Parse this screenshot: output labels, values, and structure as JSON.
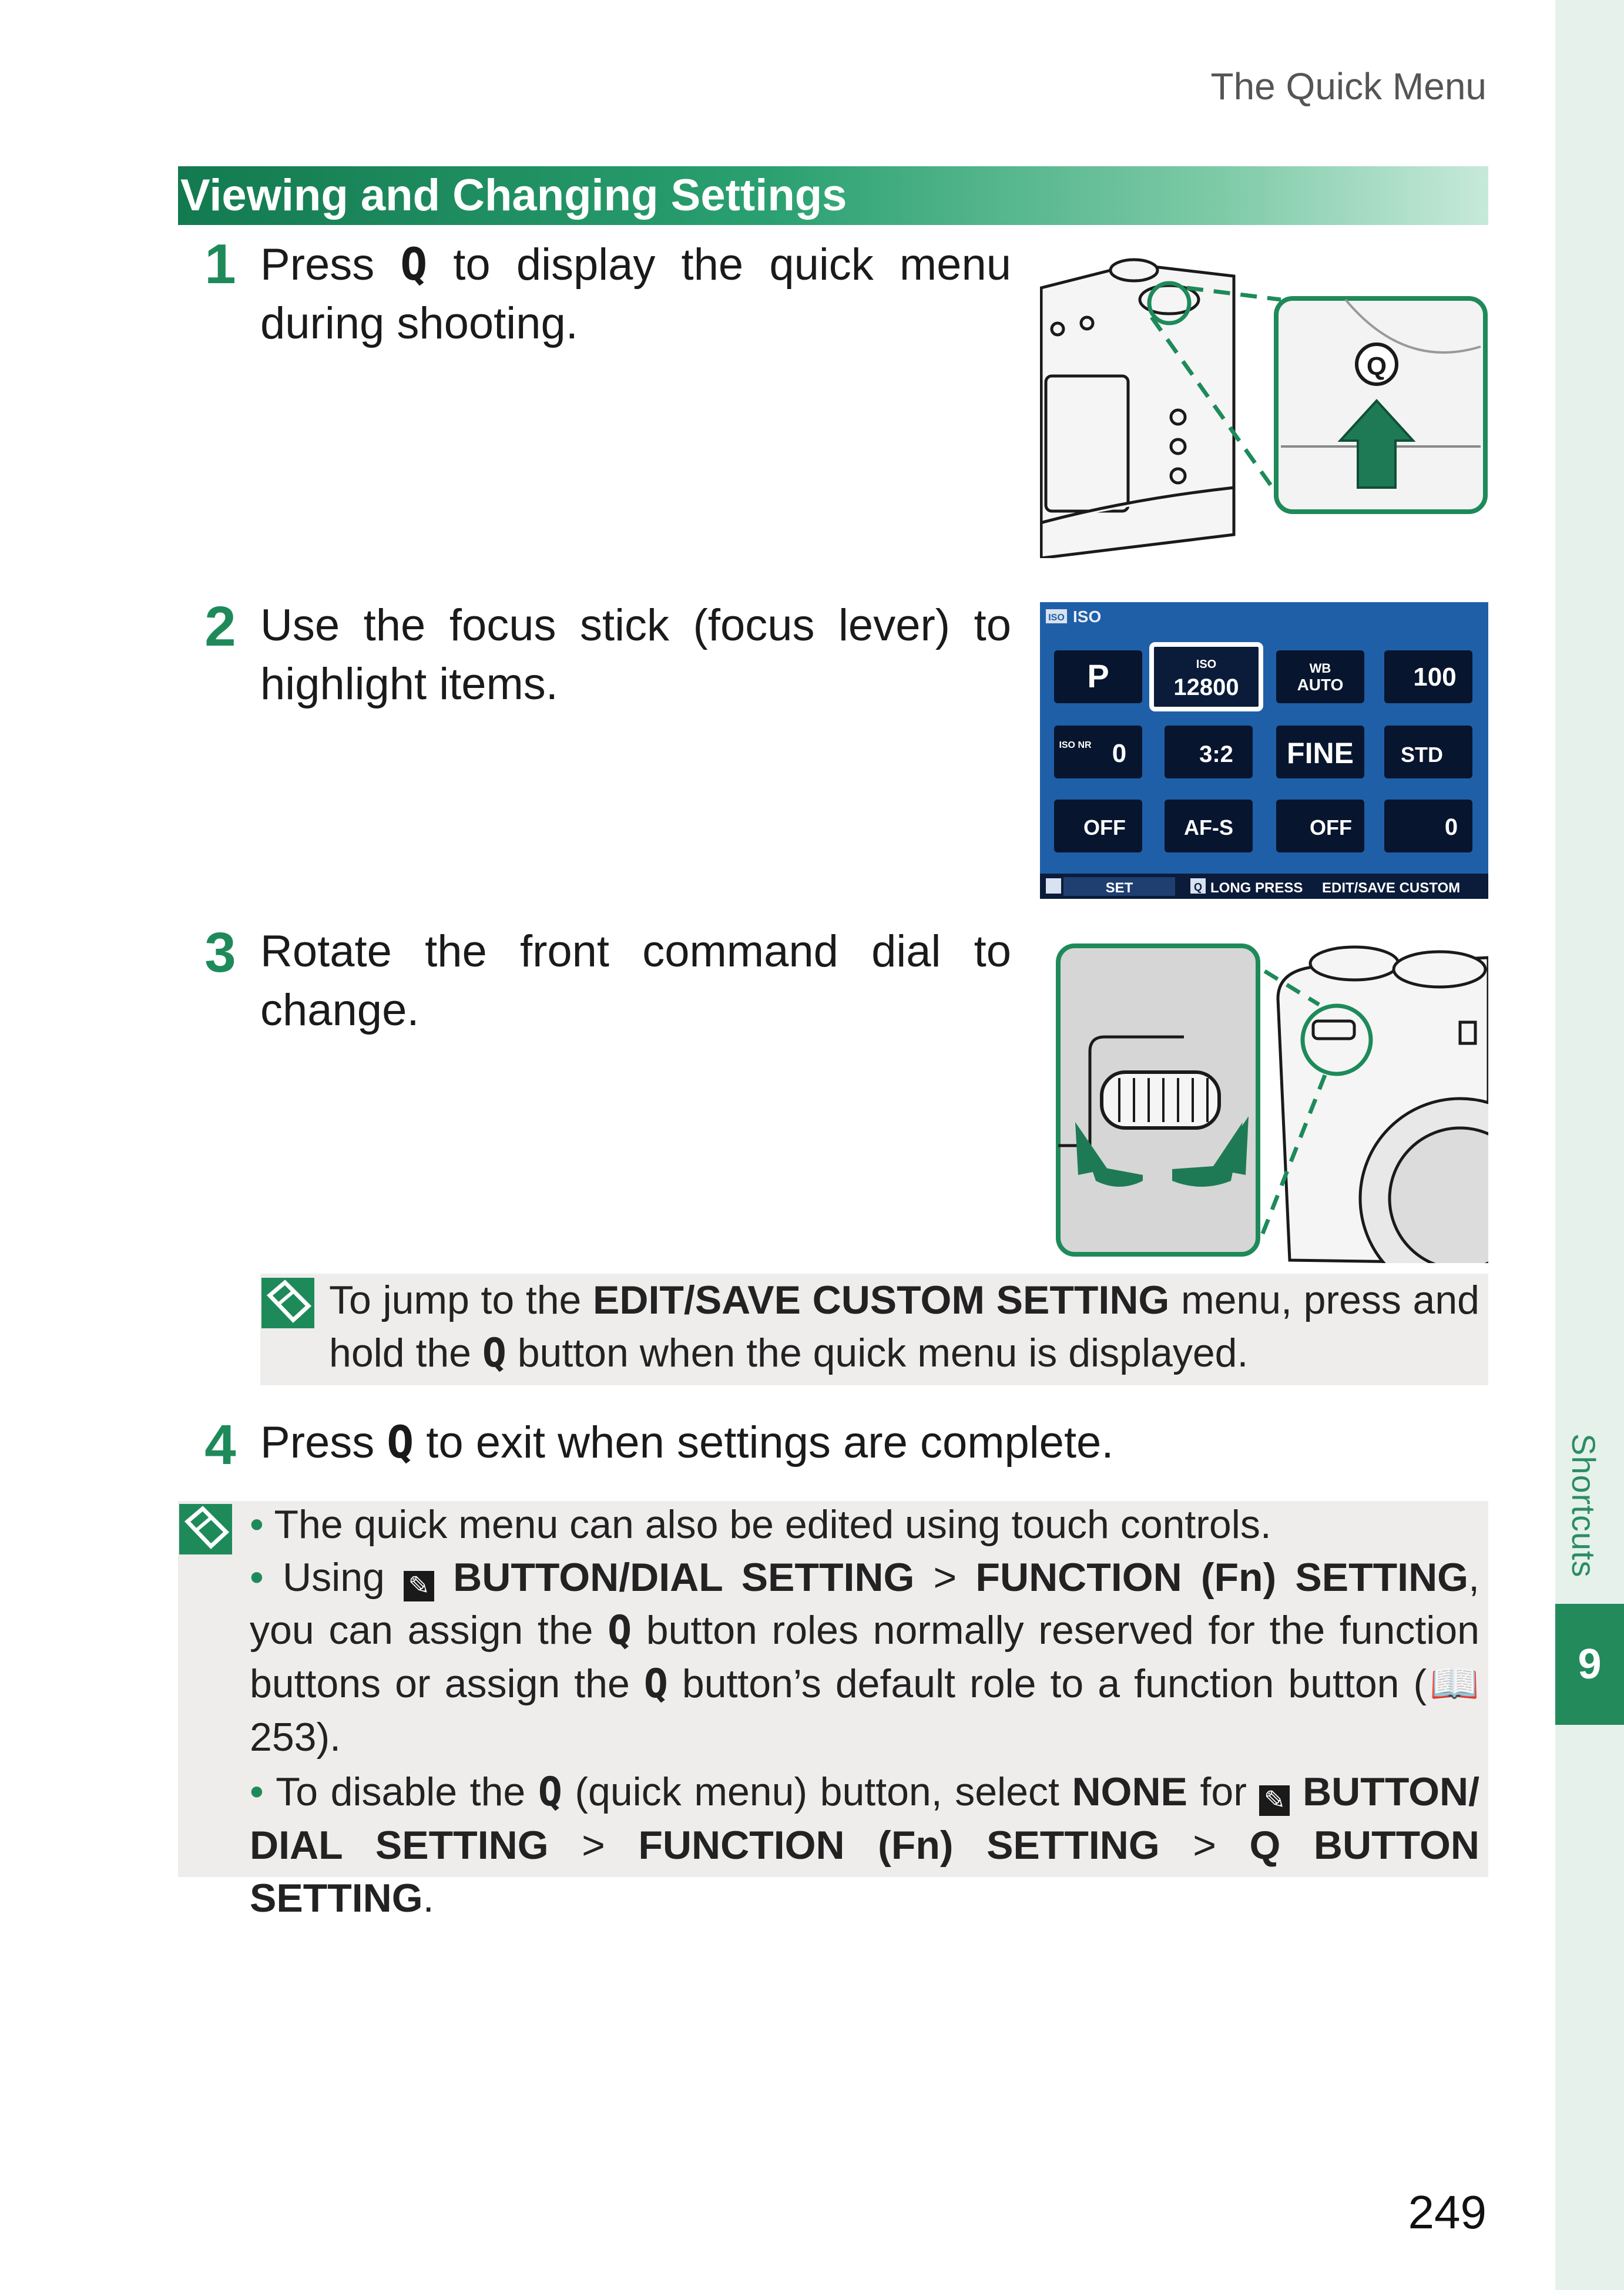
{
  "header": {
    "section_title": "The Quick Menu"
  },
  "section": {
    "title": "Viewing and Changing Settings"
  },
  "sidebar": {
    "chapter_label": "Shortcuts",
    "chapter_number": "9"
  },
  "steps": [
    {
      "number": "1",
      "pre": "Press ",
      "glyph": "Q",
      "post": " to display the quick menu during shooting."
    },
    {
      "number": "2",
      "text": "Use the focus stick (focus lever) to highlight items."
    },
    {
      "number": "3",
      "text": "Rotate the front command dial to change."
    },
    {
      "number": "4",
      "pre": "Press ",
      "glyph": "Q",
      "post": " to exit when settings are complete."
    }
  ],
  "quick_menu": {
    "top_label": "ISO",
    "tiles": [
      [
        "P",
        "12800",
        "AUTO",
        "100"
      ],
      [
        "0",
        "3:2",
        "FINE",
        "STD"
      ],
      [
        "OFF",
        "AF-S",
        "OFF",
        "0"
      ]
    ],
    "tile_badges": {
      "iso": "ISO",
      "auto": "AUTO",
      "wb": "WB",
      "nr": "ISO NR"
    },
    "bottom_left": "SET",
    "bottom_mid": "LONG PRESS",
    "bottom_right": "EDIT/SAVE CUSTOM",
    "q_badge": "Q",
    "colors": {
      "bg": "#1f5fa8",
      "tile": "#08152e",
      "bar": "#0b1c3a"
    }
  },
  "camera_q_label": "Q",
  "tip": {
    "t1": "To jump to the ",
    "b1": "EDIT/SAVE CUSTOM SETTING",
    "t2": " menu, press and hold the ",
    "glyph": "Q",
    "t3": " button when the quick menu is displayed."
  },
  "notes": {
    "n1": "The quick menu can also be edited using touch controls.",
    "n2_a": "Using ",
    "n2_b": "BUTTON/DIAL SETTING",
    "n2_c": " > ",
    "n2_d": "FUNCTION (Fn) SETTING",
    "n2_e": ", you can assign the ",
    "n2_glyph": "Q",
    "n2_f": " button roles normally reserved for the function buttons or assign the ",
    "n2_glyph2": "Q",
    "n2_g": " button’s default role to a function button (",
    "n2_ref": "253",
    "n2_h": ").",
    "n3_a": "To disable the ",
    "n3_glyph": "Q",
    "n3_b": " (quick menu) button, select ",
    "n3_c": "NONE",
    "n3_d": " for ",
    "n3_e": "BUTTON/ DIAL SETTING",
    "n3_f": " > ",
    "n3_g": "FUNCTION (Fn) SETTING",
    "n3_h": " > ",
    "n3_i": "Q BUTTON SETTING",
    "n3_j": "."
  },
  "page_number": "249"
}
